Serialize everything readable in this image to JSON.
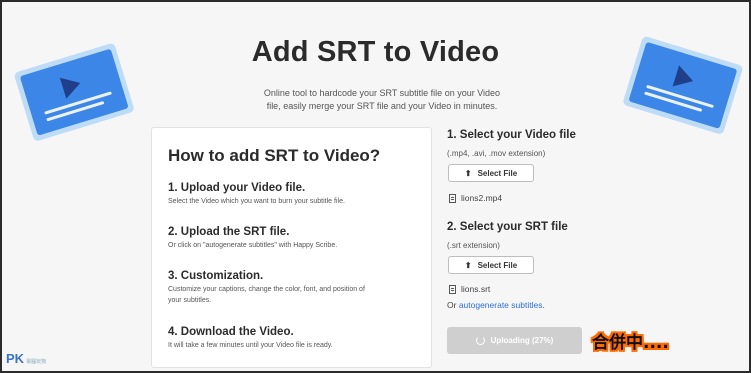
{
  "page": {
    "title": "Add SRT to Video",
    "subtitle_line1": "Online tool to hardcode your SRT subtitle file on your Video",
    "subtitle_line2": "file, easily merge your SRT file and your Video in minutes."
  },
  "howto": {
    "heading": "How to add SRT to Video?",
    "steps": [
      {
        "title": "1. Upload your Video file.",
        "desc1": "Select the Video which you want to burn your subtitle file.",
        "desc2": ""
      },
      {
        "title": "2. Upload the SRT file.",
        "desc1": "Or click on \"autogenerate subtitles\" with Happy Scribe.",
        "desc2": ""
      },
      {
        "title": "3. Customization.",
        "desc1": "Customize your captions, change the color, font, and position of",
        "desc2": "your subtitles."
      },
      {
        "title": "4. Download the Video.",
        "desc1": "It will take a few minutes until your Video file is ready.",
        "desc2": ""
      }
    ]
  },
  "video_upload": {
    "heading": "1.  Select your Video file",
    "extensions": "(.mp4, .avi, .mov extension)",
    "button_label": "Select File",
    "file_name": "lions2.mp4"
  },
  "srt_upload": {
    "heading": "2.  Select your SRT file",
    "extensions": "(.srt extension)",
    "button_label": "Select File",
    "file_name": "lions.srt",
    "or_text": "Or ",
    "autogenerate_link": "autogenerate subtitles",
    "period": "."
  },
  "upload_button": {
    "label": "Uploading (27%)",
    "progress_percent": 27
  },
  "annotation": "合併中....",
  "watermark": {
    "text": "PK",
    "small": "電腦玩物"
  },
  "colors": {
    "accent_blue": "#2f6fd6",
    "illustration_blue": "#3b86e6",
    "annotation_outline": "#ff6a00"
  }
}
